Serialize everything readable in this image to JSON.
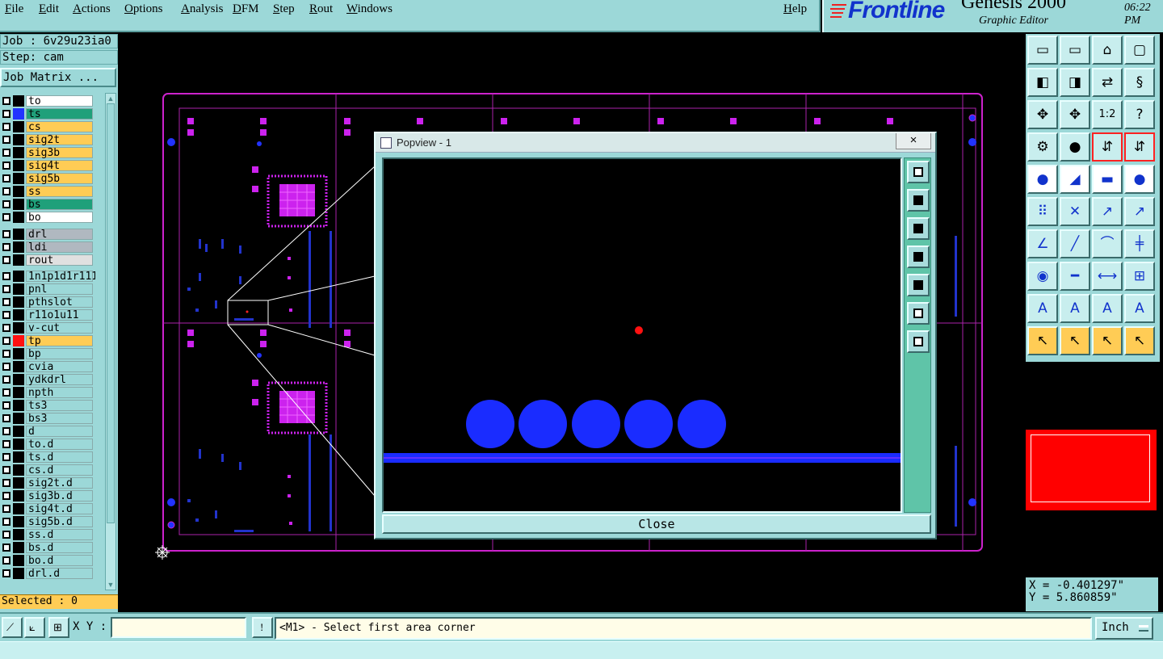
{
  "menu": {
    "items": [
      "File",
      "Edit",
      "Actions",
      "Options",
      "Analysis",
      "DFM",
      "Step",
      "Rout",
      "Windows"
    ],
    "help": "Help"
  },
  "brand": {
    "logo": "Frontline",
    "product": "Genesis 2000",
    "subtitle": "Graphic Editor",
    "time": "06:22 PM"
  },
  "job": {
    "job_label": "Job : 6v29u23ia0",
    "step_label": "Step: cam",
    "matrix_button": "Job Matrix ..."
  },
  "layers": [
    {
      "name": "to",
      "color": "#ffffff",
      "swatch": ""
    },
    {
      "name": "ts",
      "color": "#1fa07a",
      "swatch": "#2233ff"
    },
    {
      "name": "cs",
      "color": "#ffcc55",
      "swatch": ""
    },
    {
      "name": "sig2t",
      "color": "#ffcc55",
      "swatch": ""
    },
    {
      "name": "sig3b",
      "color": "#ffcc55",
      "swatch": ""
    },
    {
      "name": "sig4t",
      "color": "#ffcc55",
      "swatch": ""
    },
    {
      "name": "sig5b",
      "color": "#ffcc55",
      "swatch": ""
    },
    {
      "name": "ss",
      "color": "#ffcc55",
      "swatch": ""
    },
    {
      "name": "bs",
      "color": "#1fa07a",
      "swatch": ""
    },
    {
      "name": "bo",
      "color": "#ffffff",
      "swatch": ""
    },
    {
      "name": "drl",
      "color": "#b0b8c0",
      "swatch": ""
    },
    {
      "name": "ldi",
      "color": "#b0b8c0",
      "swatch": ""
    },
    {
      "name": "rout",
      "color": "#e0e0e0",
      "swatch": ""
    },
    {
      "name": "1n1p1d1r111",
      "color": "#9cd8d8",
      "swatch": ""
    },
    {
      "name": "pnl",
      "color": "#9cd8d8",
      "swatch": ""
    },
    {
      "name": "pthslot",
      "color": "#9cd8d8",
      "swatch": ""
    },
    {
      "name": "r11o1u11",
      "color": "#9cd8d8",
      "swatch": ""
    },
    {
      "name": "v-cut",
      "color": "#9cd8d8",
      "swatch": ""
    },
    {
      "name": "tp",
      "color": "#ffcc55",
      "swatch": "#ff1111"
    },
    {
      "name": "bp",
      "color": "#9cd8d8",
      "swatch": ""
    },
    {
      "name": "cvia",
      "color": "#9cd8d8",
      "swatch": ""
    },
    {
      "name": "ydkdrl",
      "color": "#9cd8d8",
      "swatch": ""
    },
    {
      "name": "npth",
      "color": "#9cd8d8",
      "swatch": ""
    },
    {
      "name": "ts3",
      "color": "#9cd8d8",
      "swatch": ""
    },
    {
      "name": "bs3",
      "color": "#9cd8d8",
      "swatch": ""
    },
    {
      "name": "d",
      "color": "#9cd8d8",
      "swatch": ""
    },
    {
      "name": "to.d",
      "color": "#9cd8d8",
      "swatch": ""
    },
    {
      "name": "ts.d",
      "color": "#9cd8d8",
      "swatch": ""
    },
    {
      "name": "cs.d",
      "color": "#9cd8d8",
      "swatch": ""
    },
    {
      "name": "sig2t.d",
      "color": "#9cd8d8",
      "swatch": ""
    },
    {
      "name": "sig3b.d",
      "color": "#9cd8d8",
      "swatch": ""
    },
    {
      "name": "sig4t.d",
      "color": "#9cd8d8",
      "swatch": ""
    },
    {
      "name": "sig5b.d",
      "color": "#9cd8d8",
      "swatch": ""
    },
    {
      "name": "ss.d",
      "color": "#9cd8d8",
      "swatch": ""
    },
    {
      "name": "bs.d",
      "color": "#9cd8d8",
      "swatch": ""
    },
    {
      "name": "bo.d",
      "color": "#9cd8d8",
      "swatch": ""
    },
    {
      "name": "drl.d",
      "color": "#9cd8d8",
      "swatch": ""
    }
  ],
  "selected_label": "Selected : 0",
  "popview": {
    "title": "Popview - 1",
    "close_x": "×",
    "close_button": "Close"
  },
  "coords": {
    "x": "X = -0.401297\"",
    "y": "Y = 5.860859\""
  },
  "bottom": {
    "xy_label": "X Y :",
    "xy_value": "",
    "bang": "!",
    "message": "<M1> - Select first area corner",
    "units": "Inch"
  },
  "colors": {
    "panel": "#9cd8d8",
    "board_outline": "#cc22cc",
    "pads": "#2233ff",
    "popview_pads": "#1a2cff",
    "selected_bar": "#ffcc55"
  }
}
